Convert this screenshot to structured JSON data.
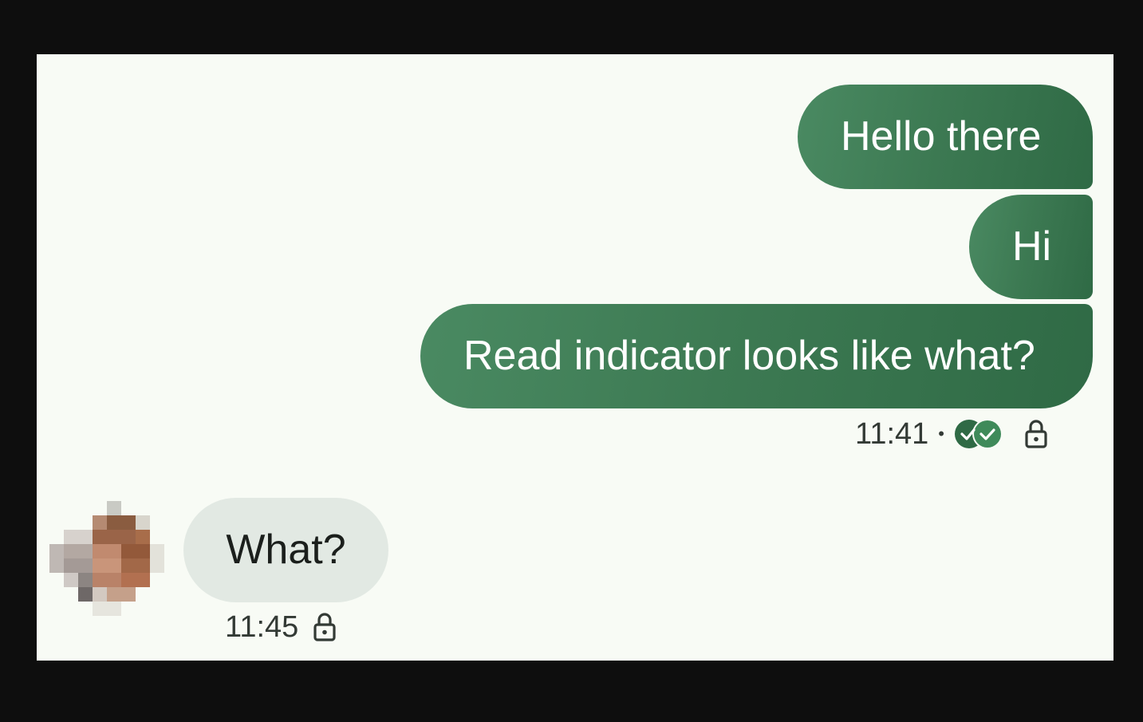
{
  "conversation": {
    "sent": [
      {
        "text": "Hello there"
      },
      {
        "text": "Hi"
      },
      {
        "text": "Read indicator looks like what?"
      }
    ],
    "sent_meta": {
      "time": "11:41",
      "separator": "•",
      "read_icon": "double-check-read-icon",
      "lock_icon": "lock-icon"
    },
    "received": [
      {
        "text": "What?"
      }
    ],
    "received_meta": {
      "time": "11:45",
      "lock_icon": "lock-icon"
    }
  },
  "colors": {
    "sent_bubble": "#3d7a53",
    "received_bubble": "#e2e9e3",
    "background": "#f8fbf5",
    "frame": "#0e0e0e"
  }
}
